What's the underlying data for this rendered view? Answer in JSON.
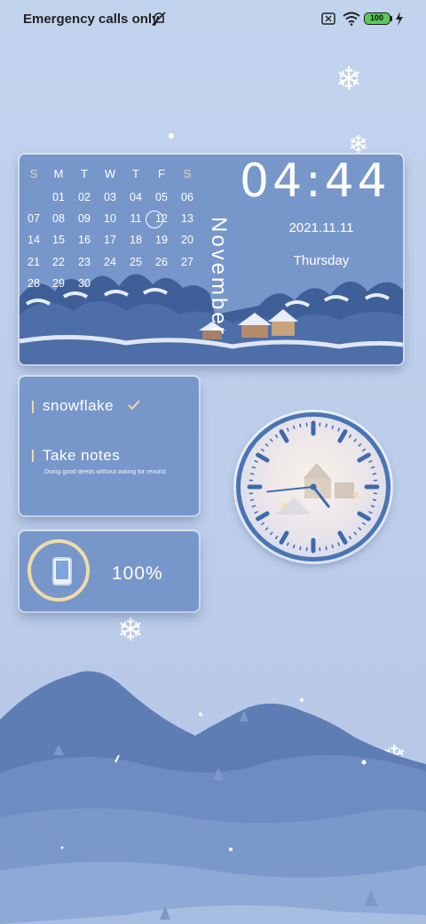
{
  "status_bar": {
    "carrier_text": "Emergency calls only",
    "battery_level": "100",
    "icons": [
      "bell-off-icon",
      "sim-icon",
      "wifi-icon",
      "battery-icon",
      "charging-icon"
    ]
  },
  "calendar": {
    "weekday_headers": [
      "S",
      "M",
      "T",
      "W",
      "T",
      "F",
      "S"
    ],
    "rows": [
      [
        "",
        "01",
        "02",
        "03",
        "04",
        "05",
        "06"
      ],
      [
        "07",
        "08",
        "09",
        "10",
        "11",
        "12",
        "13"
      ],
      [
        "14",
        "15",
        "16",
        "17",
        "18",
        "19",
        "20"
      ],
      [
        "21",
        "22",
        "23",
        "24",
        "25",
        "26",
        "27"
      ],
      [
        "28",
        "29",
        "30",
        "",
        "",
        "",
        ""
      ]
    ],
    "today": "11",
    "month_name": "November",
    "time": "04:44",
    "date": "2021.11.11",
    "weekday": "Thursday",
    "weekend_color": "#e9d59a"
  },
  "todo": {
    "items": [
      {
        "title": "snowflake",
        "checked": true
      },
      {
        "title": "Take notes",
        "subtitle": "Doing good deeds without asking for reward"
      }
    ]
  },
  "battery_widget": {
    "percent_text": "100%"
  },
  "analog_clock": {
    "hour": 4,
    "minute": 44
  },
  "colors": {
    "widget_bg": "#7797cb",
    "accent": "#4a75b4",
    "mountain": "#5f7db5"
  }
}
